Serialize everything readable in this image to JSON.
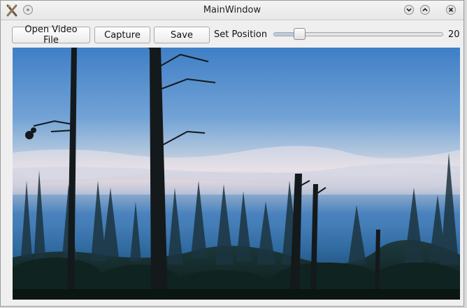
{
  "window": {
    "title": "MainWindow"
  },
  "toolbar": {
    "open_label": "Open Video File",
    "capture_label": "Capture",
    "save_label": "Save",
    "position_label": "Set Position",
    "position_value": "20",
    "slider_fraction": 0.13
  },
  "icons": {
    "app": "app-x-icon",
    "titlebar_menu": "circle-menu-icon",
    "minimize": "chevron-down-icon",
    "maximize": "chevron-up-icon",
    "close": "close-icon"
  },
  "colors": {
    "accent": "#b9cce3",
    "window_bg": "#efefef"
  }
}
